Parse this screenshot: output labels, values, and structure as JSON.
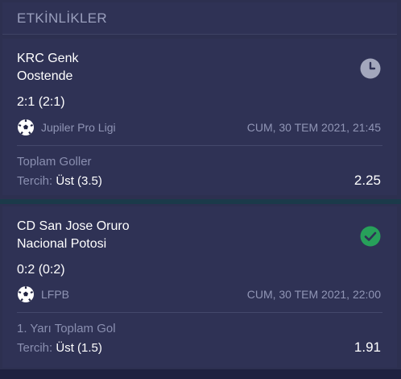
{
  "header": {
    "title": "ETKİNLİKLER"
  },
  "events": [
    {
      "home": "KRC Genk",
      "away": "Oostende",
      "score": "2:1 (2:1)",
      "league": "Jupiler Pro Ligi",
      "date": "CUM, 30 TEM 2021, 21:45",
      "market": "Toplam Goller",
      "choice_label": "Tercih:",
      "choice_value": "Üst (3.5)",
      "odds": "2.25",
      "status_icon": "clock-icon"
    },
    {
      "home": "CD San Jose Oruro",
      "away": "Nacional Potosi",
      "score": "0:2 (0:2)",
      "league": "LFPB",
      "date": "CUM, 30 TEM 2021, 22:00",
      "market": "1. Yarı Toplam Gol",
      "choice_label": "Tercih:",
      "choice_value": "Üst (1.5)",
      "odds": "1.91",
      "status_icon": "check-circle-icon"
    }
  ],
  "colors": {
    "background": "#2f3255",
    "muted_text": "#8a8fb0",
    "pending_icon": "#a3a7bd",
    "won_icon": "#27a05a"
  }
}
